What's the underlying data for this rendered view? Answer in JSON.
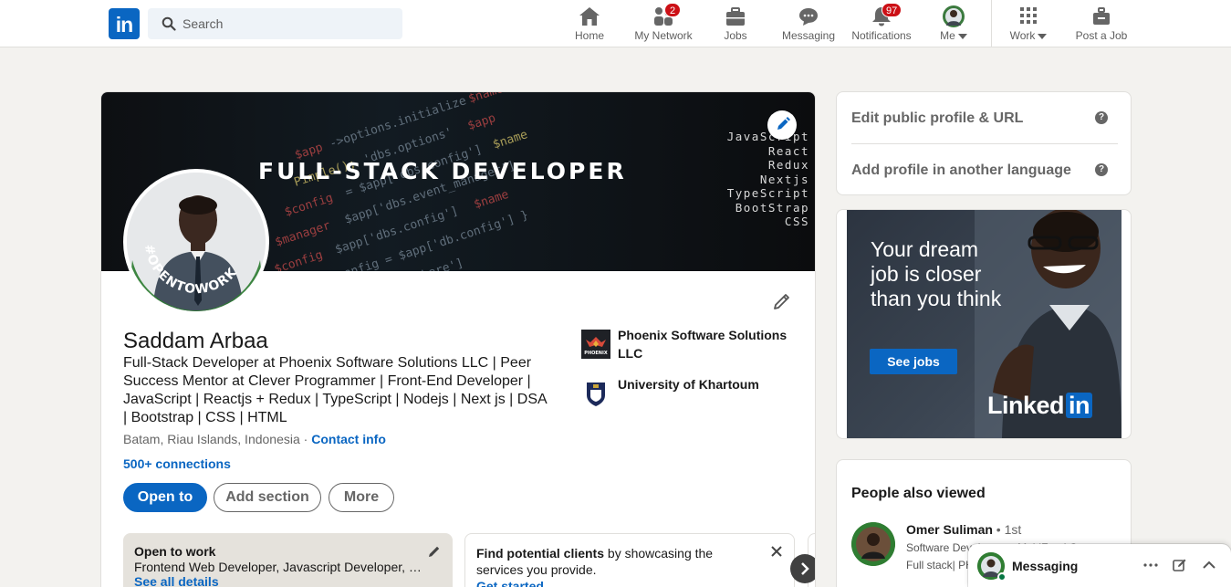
{
  "nav": {
    "logo": "in",
    "search_placeholder": "Search",
    "items": [
      {
        "label": "Home",
        "icon": "home-icon"
      },
      {
        "label": "My Network",
        "icon": "network-icon",
        "badge": "2"
      },
      {
        "label": "Jobs",
        "icon": "briefcase-icon"
      },
      {
        "label": "Messaging",
        "icon": "chat-icon"
      },
      {
        "label": "Notifications",
        "icon": "bell-icon",
        "badge": "97"
      },
      {
        "label": "Me",
        "icon": "avatar"
      },
      {
        "label": "Work",
        "icon": "grid-icon"
      },
      {
        "label": "Post a Job",
        "icon": "post-job-icon"
      }
    ]
  },
  "profile": {
    "banner": {
      "title": "FULL-STACK DEVELOPER",
      "tech": [
        "JavaScript",
        "React",
        "Redux",
        "Nextjs",
        "TypeScript",
        "BootStrap",
        "CSS"
      ]
    },
    "avatar_ring_text": "#OPENTOWORK",
    "name": "Saddam Arbaa",
    "headline": "Full-Stack Developer at Phoenix Software Solutions LLC | Peer Success Mentor at Clever Programmer | Front-End Developer | JavaScript | Reactjs + Redux | TypeScript | Nodejs | Next js | DSA | Bootstrap | CSS | HTML",
    "location": "Batam, Riau Islands, Indonesia",
    "separator": "·",
    "contact_info": "Contact info",
    "connections": "500+ connections",
    "experience": [
      {
        "name": "Phoenix Software Solutions LLC",
        "logo_text": "PHOENIX"
      },
      {
        "name": "University of Khartoum"
      }
    ],
    "buttons": {
      "open_to": "Open to",
      "add_section": "Add section",
      "more": "More"
    },
    "open_to_work": {
      "title": "Open to work",
      "details": "Frontend Web Developer, Javascript Developer, F...",
      "link": "See all details"
    },
    "find_clients": {
      "bold": "Find potential clients",
      "rest": " by showcasing the services you provide.",
      "link": "Get started"
    }
  },
  "sidebar": {
    "links": [
      "Edit public profile & URL",
      "Add profile in another language"
    ],
    "help_glyph": "?",
    "ad": {
      "text": "Your dream job is closer than you think",
      "button": "See jobs",
      "brand": "Linked",
      "brand_in": "in"
    },
    "people_also_viewed": {
      "title": "People also viewed",
      "person": {
        "name": "Omer Suliman",
        "degree": " • 1st",
        "subtitle": "Software Developer at MobiFund C...",
        "subtitle2": "Full stack| PHP..."
      }
    }
  },
  "messaging": {
    "title": "Messaging"
  },
  "colors": {
    "brand": "#0a66c2",
    "badge": "#cc1016",
    "otw_green": "#2f7d32"
  }
}
